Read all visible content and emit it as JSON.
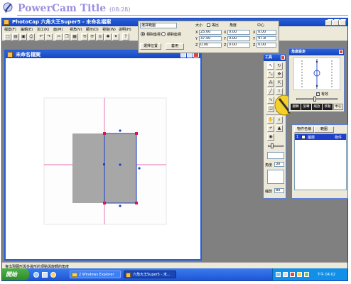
{
  "slide": {
    "title": "PowerCam Title",
    "time": "(08:28)"
  },
  "app": {
    "title": "PhotoCap 六角大王Super5 - 未命名檔案",
    "menu": [
      "檔案(F)",
      "編輯(E)",
      "加工(K)",
      "面(M)",
      "視角(V)",
      "顯示(D)",
      "視窗(W)",
      "說明(H)"
    ]
  },
  "transform": {
    "mode_select": "選擇範圍",
    "radio1": "相對座標",
    "radio2": "絕對座標",
    "btn1": "選擇位置",
    "btn2": "套用",
    "col_size": "大小",
    "check_label": "等比",
    "col_angle": "角度",
    "col_center": "中心",
    "x_label": "X",
    "y_label": "Y",
    "z_label": "Z",
    "size_x": "25.00",
    "size_y": "37.50",
    "size_z": "0.00",
    "angle_x": "0.00",
    "angle_y": "0.00",
    "angle_z": "0.00",
    "center_x": "0.00",
    "center_y": "47.8",
    "center_z": "0.00"
  },
  "doc_window": {
    "title": "未命名檔案"
  },
  "toolbox": {
    "title": "工具",
    "spin_label": "角度",
    "spin_value": "30",
    "zoom_label": "縮放",
    "zoom_value": "80"
  },
  "mirror": {
    "title": "角度設定",
    "checkbox": "有效",
    "tabs": [
      "翻轉",
      "旋轉",
      "縮放",
      "移動",
      "中心"
    ]
  },
  "layers": {
    "col1": "物件名稱",
    "col2": "範圍",
    "row_num": "1",
    "row_name": "圖層",
    "row_type": "物件"
  },
  "status": {
    "text": "會出現圓形與多邊形的頂點與旋轉的角度"
  },
  "taskbar": {
    "start": "開始",
    "task1": "2 Windows Explorer",
    "task2": "六角大王Super5 - 未...",
    "clock": "下午 04:02"
  },
  "colors": {
    "xp_blue": "#245edb",
    "gray_bg": "#808080",
    "shape_fill": "#a7a7a7",
    "guide_pink": "#e0409a",
    "selection_blue": "#1f3fc8",
    "title_purple": "#9c8fe0"
  }
}
